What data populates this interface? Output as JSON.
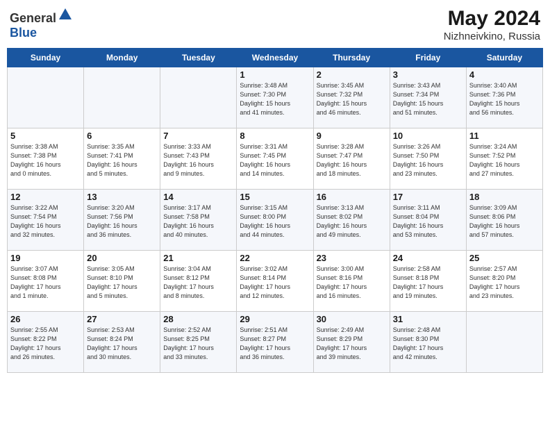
{
  "header": {
    "logo_general": "General",
    "logo_blue": "Blue",
    "title": "May 2024",
    "location": "Nizhneivkino, Russia"
  },
  "weekdays": [
    "Sunday",
    "Monday",
    "Tuesday",
    "Wednesday",
    "Thursday",
    "Friday",
    "Saturday"
  ],
  "weeks": [
    [
      {
        "day": "",
        "info": ""
      },
      {
        "day": "",
        "info": ""
      },
      {
        "day": "",
        "info": ""
      },
      {
        "day": "1",
        "info": "Sunrise: 3:48 AM\nSunset: 7:30 PM\nDaylight: 15 hours\nand 41 minutes."
      },
      {
        "day": "2",
        "info": "Sunrise: 3:45 AM\nSunset: 7:32 PM\nDaylight: 15 hours\nand 46 minutes."
      },
      {
        "day": "3",
        "info": "Sunrise: 3:43 AM\nSunset: 7:34 PM\nDaylight: 15 hours\nand 51 minutes."
      },
      {
        "day": "4",
        "info": "Sunrise: 3:40 AM\nSunset: 7:36 PM\nDaylight: 15 hours\nand 56 minutes."
      }
    ],
    [
      {
        "day": "5",
        "info": "Sunrise: 3:38 AM\nSunset: 7:38 PM\nDaylight: 16 hours\nand 0 minutes."
      },
      {
        "day": "6",
        "info": "Sunrise: 3:35 AM\nSunset: 7:41 PM\nDaylight: 16 hours\nand 5 minutes."
      },
      {
        "day": "7",
        "info": "Sunrise: 3:33 AM\nSunset: 7:43 PM\nDaylight: 16 hours\nand 9 minutes."
      },
      {
        "day": "8",
        "info": "Sunrise: 3:31 AM\nSunset: 7:45 PM\nDaylight: 16 hours\nand 14 minutes."
      },
      {
        "day": "9",
        "info": "Sunrise: 3:28 AM\nSunset: 7:47 PM\nDaylight: 16 hours\nand 18 minutes."
      },
      {
        "day": "10",
        "info": "Sunrise: 3:26 AM\nSunset: 7:50 PM\nDaylight: 16 hours\nand 23 minutes."
      },
      {
        "day": "11",
        "info": "Sunrise: 3:24 AM\nSunset: 7:52 PM\nDaylight: 16 hours\nand 27 minutes."
      }
    ],
    [
      {
        "day": "12",
        "info": "Sunrise: 3:22 AM\nSunset: 7:54 PM\nDaylight: 16 hours\nand 32 minutes."
      },
      {
        "day": "13",
        "info": "Sunrise: 3:20 AM\nSunset: 7:56 PM\nDaylight: 16 hours\nand 36 minutes."
      },
      {
        "day": "14",
        "info": "Sunrise: 3:17 AM\nSunset: 7:58 PM\nDaylight: 16 hours\nand 40 minutes."
      },
      {
        "day": "15",
        "info": "Sunrise: 3:15 AM\nSunset: 8:00 PM\nDaylight: 16 hours\nand 44 minutes."
      },
      {
        "day": "16",
        "info": "Sunrise: 3:13 AM\nSunset: 8:02 PM\nDaylight: 16 hours\nand 49 minutes."
      },
      {
        "day": "17",
        "info": "Sunrise: 3:11 AM\nSunset: 8:04 PM\nDaylight: 16 hours\nand 53 minutes."
      },
      {
        "day": "18",
        "info": "Sunrise: 3:09 AM\nSunset: 8:06 PM\nDaylight: 16 hours\nand 57 minutes."
      }
    ],
    [
      {
        "day": "19",
        "info": "Sunrise: 3:07 AM\nSunset: 8:08 PM\nDaylight: 17 hours\nand 1 minute."
      },
      {
        "day": "20",
        "info": "Sunrise: 3:05 AM\nSunset: 8:10 PM\nDaylight: 17 hours\nand 5 minutes."
      },
      {
        "day": "21",
        "info": "Sunrise: 3:04 AM\nSunset: 8:12 PM\nDaylight: 17 hours\nand 8 minutes."
      },
      {
        "day": "22",
        "info": "Sunrise: 3:02 AM\nSunset: 8:14 PM\nDaylight: 17 hours\nand 12 minutes."
      },
      {
        "day": "23",
        "info": "Sunrise: 3:00 AM\nSunset: 8:16 PM\nDaylight: 17 hours\nand 16 minutes."
      },
      {
        "day": "24",
        "info": "Sunrise: 2:58 AM\nSunset: 8:18 PM\nDaylight: 17 hours\nand 19 minutes."
      },
      {
        "day": "25",
        "info": "Sunrise: 2:57 AM\nSunset: 8:20 PM\nDaylight: 17 hours\nand 23 minutes."
      }
    ],
    [
      {
        "day": "26",
        "info": "Sunrise: 2:55 AM\nSunset: 8:22 PM\nDaylight: 17 hours\nand 26 minutes."
      },
      {
        "day": "27",
        "info": "Sunrise: 2:53 AM\nSunset: 8:24 PM\nDaylight: 17 hours\nand 30 minutes."
      },
      {
        "day": "28",
        "info": "Sunrise: 2:52 AM\nSunset: 8:25 PM\nDaylight: 17 hours\nand 33 minutes."
      },
      {
        "day": "29",
        "info": "Sunrise: 2:51 AM\nSunset: 8:27 PM\nDaylight: 17 hours\nand 36 minutes."
      },
      {
        "day": "30",
        "info": "Sunrise: 2:49 AM\nSunset: 8:29 PM\nDaylight: 17 hours\nand 39 minutes."
      },
      {
        "day": "31",
        "info": "Sunrise: 2:48 AM\nSunset: 8:30 PM\nDaylight: 17 hours\nand 42 minutes."
      },
      {
        "day": "",
        "info": ""
      }
    ]
  ]
}
